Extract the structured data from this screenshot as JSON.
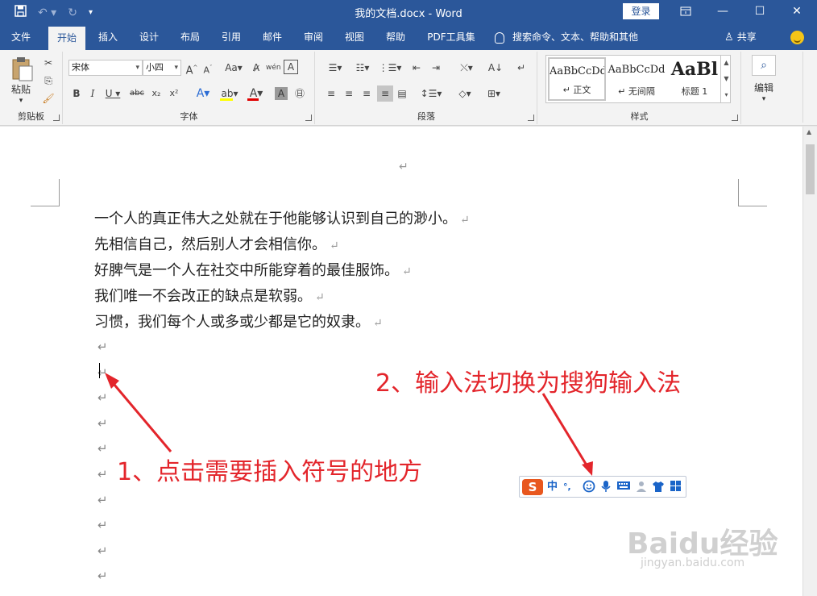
{
  "titlebar": {
    "save_icon": "save-icon",
    "undo_icon": "undo-icon",
    "redo_icon": "redo-icon",
    "customize_icon": "customize-qat-icon",
    "title": "我的文档.docx  -  Word",
    "login": "登录",
    "ribbon_display_icon": "ribbon-display-icon",
    "minimize": "—",
    "maximize": "☐",
    "close": "✕"
  },
  "tabs": [
    "文件",
    "开始",
    "插入",
    "设计",
    "布局",
    "引用",
    "邮件",
    "审阅",
    "视图",
    "帮助",
    "PDF工具集"
  ],
  "active_tab": "开始",
  "tell_me": "搜索命令、文本、帮助和其他",
  "share": "共享",
  "ribbon": {
    "clipboard": {
      "label": "剪贴板",
      "paste": "粘贴"
    },
    "font": {
      "label": "字体",
      "font_name": "宋体",
      "font_size": "小四"
    },
    "paragraph": {
      "label": "段落"
    },
    "styles": {
      "label": "样式",
      "items": [
        {
          "sample": "AaBbCcDd",
          "name": "↵ 正文"
        },
        {
          "sample": "AaBbCcDd",
          "name": "↵ 无间隔"
        },
        {
          "sample": "AaBl",
          "name": "标题 1"
        }
      ]
    },
    "editing": {
      "label": "编辑"
    }
  },
  "document": {
    "lines": [
      "一个人的真正伟大之处就在于他能够认识到自己的渺小。",
      "先相信自己，然后别人才会相信你。",
      "好脾气是一个人在社交中所能穿着的最佳服饰。",
      "我们唯一不会改正的缺点是软弱。",
      "习惯，我们每个人或多或少都是它的奴隶。"
    ],
    "paragraph_mark": "↵",
    "empty_paragraph_count": 10
  },
  "annotations": {
    "step1": "1、点击需要插入符号的地方",
    "step2": "2、输入法切换为搜狗输入法"
  },
  "sogou_toolbar": {
    "logo": "S",
    "mode": "中",
    "punct": "°,",
    "icons": [
      "emoji-icon",
      "microphone-icon",
      "keyboard-icon",
      "user-icon",
      "skin-shirt-icon",
      "toolbox-icon"
    ]
  },
  "watermark": {
    "brand": "Baidu经验",
    "url": "jingyan.baidu.com"
  },
  "colors": {
    "word_blue": "#2b579a",
    "annotation_red": "#e3252b",
    "sogou_orange": "#e8571e"
  }
}
